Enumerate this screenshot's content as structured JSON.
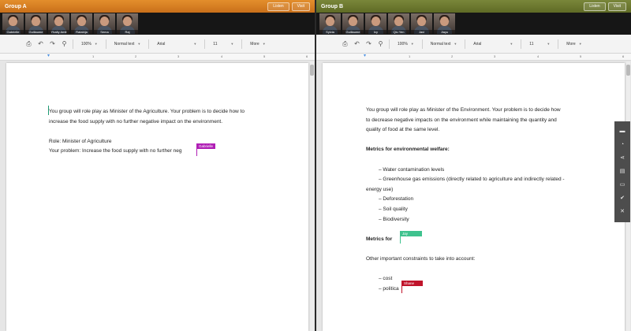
{
  "group_a": {
    "title": "Group A",
    "buttons": [
      "Listen",
      "Visit"
    ],
    "participants": [
      "Gabrielle",
      "Guillaume",
      "Yhalty Amit",
      "Ratabija",
      "Sema",
      "Raj"
    ],
    "toolbar": {
      "zoom": "100%",
      "style": "Normal text",
      "font": "Arial",
      "size": "11",
      "more": "More"
    },
    "ruler": [
      "1",
      "2",
      "3",
      "4",
      "5",
      "6"
    ],
    "doc": {
      "p1a": "You group will role play as Minister of the Agriculture. Your problem is to decide how to",
      "p1b": "increase the food supply with no further negative impact on the environment.",
      "role": "Role: Minister of Agriculture",
      "problem": "Your problem: Increase the food supply with no further neg"
    },
    "cursor": {
      "name": "Gabrielle",
      "color": "#b01fb5"
    }
  },
  "group_b": {
    "title": "Group B",
    "buttons": [
      "Listen",
      "Visit"
    ],
    "participants": [
      "Sylvia",
      "Guillaume",
      "Ivy",
      "Qiu Yen",
      "Javi",
      "Jiayu"
    ],
    "toolbar": {
      "zoom": "100%",
      "style": "Normal text",
      "font": "Arial",
      "size": "11",
      "more": "More"
    },
    "ruler": [
      "1",
      "2",
      "3",
      "4",
      "5",
      "6"
    ],
    "doc": {
      "p1a": "You group will role play as Minister of the Environment. Your problem is to decide how",
      "p1b": "to decrease negative impacts on the environment while maintaining the quantity and",
      "p1c": "quality of food at the same level.",
      "metrics_heading": "Metrics for environmental welfare:",
      "items": [
        "– Water contamination levels",
        "– Greenhouse gas emissions (directly related to agriculture and indirectly related -",
        "energy use)",
        "– Deforestation",
        "– Soil quality",
        "– Biodiversity"
      ],
      "metrics_for": "Metrics for",
      "constraints": "Other important constraints to take into account:",
      "cost": "– cost",
      "politics": "– politica"
    },
    "cursor_green": {
      "name": "Jay",
      "color": "#3fc28e"
    },
    "cursor_red": {
      "name": "Shane",
      "color": "#c0142b"
    }
  },
  "sidebar_icons": [
    "chat-icon",
    "pie-chart-icon",
    "share-icon",
    "document-icon",
    "monitor-icon",
    "check-icon",
    "close-icon"
  ]
}
